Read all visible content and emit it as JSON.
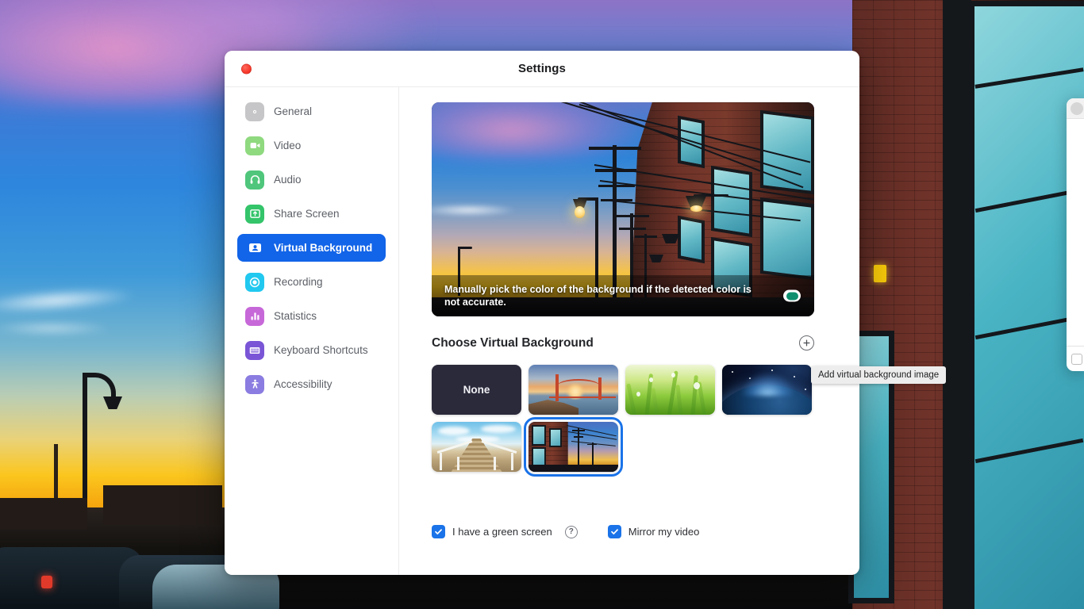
{
  "window": {
    "title": "Settings",
    "close_button": "close"
  },
  "sidebar": {
    "items": [
      {
        "label": "General",
        "icon": "gear-icon",
        "active": false
      },
      {
        "label": "Video",
        "icon": "video-camera-icon",
        "active": false
      },
      {
        "label": "Audio",
        "icon": "headphones-icon",
        "active": false
      },
      {
        "label": "Share Screen",
        "icon": "share-screen-icon",
        "active": false
      },
      {
        "label": "Virtual Background",
        "icon": "person-badge-icon",
        "active": true
      },
      {
        "label": "Recording",
        "icon": "record-circle-icon",
        "active": false
      },
      {
        "label": "Statistics",
        "icon": "bar-chart-icon",
        "active": false
      },
      {
        "label": "Keyboard Shortcuts",
        "icon": "keyboard-icon",
        "active": false
      },
      {
        "label": "Accessibility",
        "icon": "accessibility-icon",
        "active": false
      }
    ]
  },
  "preview": {
    "caption": "Manually pick the color of the background if the detected color is not accurate.",
    "swatch_color": "#0f8f6e",
    "swatch_name": "detected-background-color"
  },
  "section": {
    "title": "Choose Virtual Background",
    "add_button_glyph": "+",
    "add_button_label": "Add virtual background image"
  },
  "tooltip": {
    "text": "Add virtual background image"
  },
  "backgrounds": [
    {
      "name": "None",
      "label": "None",
      "selected": false
    },
    {
      "name": "golden-gate-bridge",
      "label": "",
      "selected": false
    },
    {
      "name": "grass-dew",
      "label": "",
      "selected": false
    },
    {
      "name": "earth-from-space",
      "label": "",
      "selected": false
    },
    {
      "name": "wooden-pier",
      "label": "",
      "selected": false
    },
    {
      "name": "city-street-sunset",
      "label": "",
      "selected": true
    }
  ],
  "options": {
    "green_screen": {
      "label": "I have a green screen",
      "checked": true,
      "help": "?"
    },
    "mirror_video": {
      "label": "Mirror my video",
      "checked": true
    }
  },
  "colors": {
    "accent": "#1264e8",
    "checkbox": "#1a73e8",
    "selection_ring": "#1a73e8",
    "close_button": "#f7392b"
  }
}
